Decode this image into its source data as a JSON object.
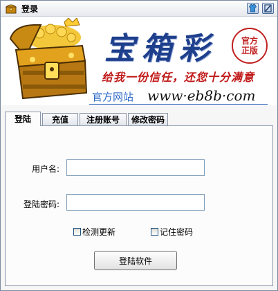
{
  "window": {
    "title": "登录"
  },
  "banner": {
    "brand": "宝箱彩",
    "seal_line1": "官方",
    "seal_line2": "正版",
    "slogan": "给我一份信任，还您十分满意",
    "site_label": "官方网站",
    "site_url": "www·eb8b·com"
  },
  "tabs": [
    {
      "label": "登陆"
    },
    {
      "label": "充值"
    },
    {
      "label": "注册账号"
    },
    {
      "label": "修改密码"
    }
  ],
  "form": {
    "username_label": "用户名:",
    "username_value": "",
    "password_label": "登陆密码:",
    "password_value": "",
    "check_update_label": "检测更新",
    "remember_password_label": "记住密码",
    "login_button": "登陆软件"
  },
  "colors": {
    "brand_blue": "#1d3f8c",
    "slogan_red": "#c01818",
    "link_blue": "#2e6ac8"
  },
  "icons": {
    "app": "treasure-chest-icon",
    "skin": "shirt-icon",
    "close": "close-icon"
  }
}
